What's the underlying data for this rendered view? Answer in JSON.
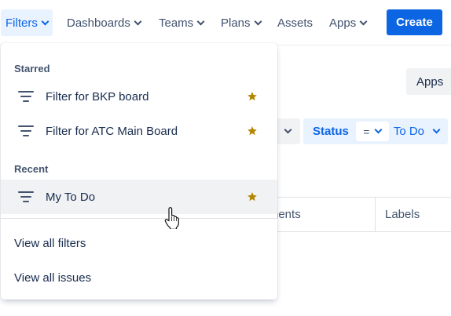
{
  "nav": {
    "items": [
      {
        "label": "Filters",
        "active": true,
        "chevron": true
      },
      {
        "label": "Dashboards",
        "active": false,
        "chevron": true
      },
      {
        "label": "Teams",
        "active": false,
        "chevron": true
      },
      {
        "label": "Plans",
        "active": false,
        "chevron": true
      },
      {
        "label": "Assets",
        "active": false,
        "chevron": false
      },
      {
        "label": "Apps",
        "active": false,
        "chevron": true
      }
    ],
    "create_label": "Create"
  },
  "background": {
    "apps_button_label": "Apps",
    "status_filter": {
      "label": "Status",
      "operator": "=",
      "value": "To Do"
    },
    "table_columns": [
      "nents",
      "Labels"
    ]
  },
  "filters_menu": {
    "starred_title": "Starred",
    "starred": [
      {
        "label": "Filter for BKP board",
        "starred": true
      },
      {
        "label": "Filter for ATC Main Board",
        "starred": true
      }
    ],
    "recent_title": "Recent",
    "recent": [
      {
        "label": "My To Do",
        "starred": true,
        "hovered": true
      }
    ],
    "view_all_filters": "View all filters",
    "view_all_issues": "View all issues"
  },
  "colors": {
    "brand_blue": "#0c66e4",
    "active_nav_bg": "#e9f2ff",
    "star_gold": "#b38600",
    "text_primary": "#172b4d",
    "text_secondary": "#44546f"
  }
}
